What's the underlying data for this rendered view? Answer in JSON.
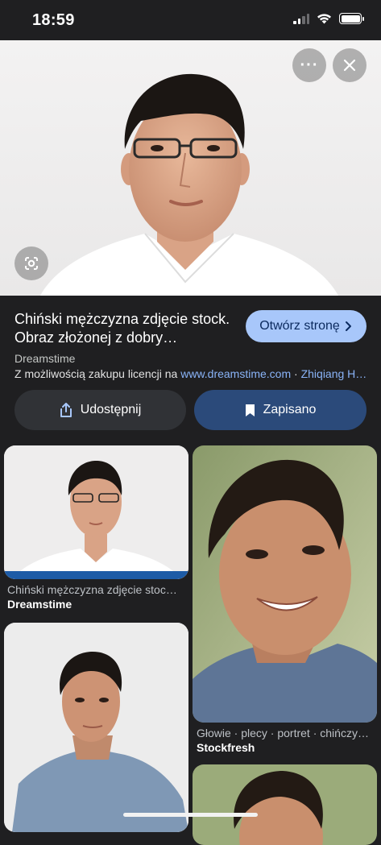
{
  "status_bar": {
    "time": "18:59"
  },
  "hero": {
    "more_label": "···"
  },
  "result": {
    "title": "Chiński mężczyzna zdjęcie stock. Obraz złożonej z dobry…",
    "open_button": "Otwórz stronę",
    "source": "Dreamstime",
    "license_prefix": "Z możliwością zakupu licencji na",
    "license_link": "www.dreamstime.com",
    "separator": "·",
    "author_link": "Zhiqiang H…"
  },
  "actions": {
    "share": "Udostępnij",
    "saved": "Zapisano"
  },
  "related": [
    {
      "caption": "Chiński mężczyzna zdjęcie stoc…",
      "source": "Dreamstime"
    },
    {
      "caption": "Głowie · plecy · portret · chińczy…",
      "source": "Stockfresh"
    }
  ],
  "colors": {
    "accent": "#a8c7fa",
    "link": "#8ab4f8",
    "saved_bg": "#2b4a7a",
    "background": "#1f1f21"
  },
  "icons": [
    "signal-icon",
    "wifi-icon",
    "battery-icon",
    "more-icon",
    "close-icon",
    "lens-icon",
    "chevron-right-icon",
    "share-icon",
    "bookmark-icon"
  ]
}
